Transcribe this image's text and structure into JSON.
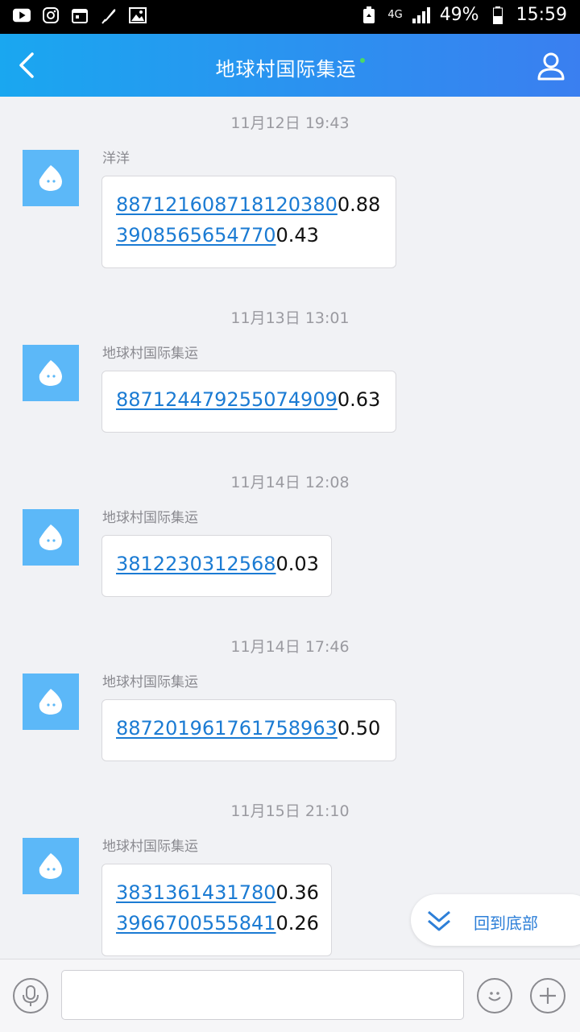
{
  "status_bar": {
    "network": "4G",
    "battery": "49%",
    "time": "15:59"
  },
  "header": {
    "title": "地球村国际集运"
  },
  "messages": [
    {
      "time": "11月12日 19:43",
      "sender": "洋洋",
      "lines": [
        {
          "link": "887121608718120380",
          "text": "0.88"
        },
        {
          "link": "3908565654770",
          "text": "0.43"
        }
      ]
    },
    {
      "time": "11月13日 13:01",
      "sender": "地球村国际集运",
      "lines": [
        {
          "link": "887124479255074909",
          "text": "0.63"
        }
      ]
    },
    {
      "time": "11月14日 12:08",
      "sender": "地球村国际集运",
      "lines": [
        {
          "link": "3812230312568",
          "text": "0.03"
        }
      ]
    },
    {
      "time": "11月14日 17:46",
      "sender": "地球村国际集运",
      "lines": [
        {
          "link": "887201961761758963",
          "text": "0.50"
        }
      ]
    },
    {
      "time": "11月15日 21:10",
      "sender": "地球村国际集运",
      "lines": [
        {
          "link": "3831361431780",
          "text": "0.36"
        },
        {
          "link": "3966700555841",
          "text": "0.26"
        }
      ]
    }
  ],
  "back_to_bottom": {
    "label": "回到底部"
  },
  "input": {
    "value": "",
    "placeholder": ""
  },
  "icons": {
    "back": "back-arrow-icon",
    "profile": "profile-icon",
    "voice": "microphone-icon",
    "emoji": "smiley-icon",
    "more": "plus-icon",
    "avatar": "chat-bubble-face-icon",
    "to_bottom": "double-chevron-down-icon"
  }
}
